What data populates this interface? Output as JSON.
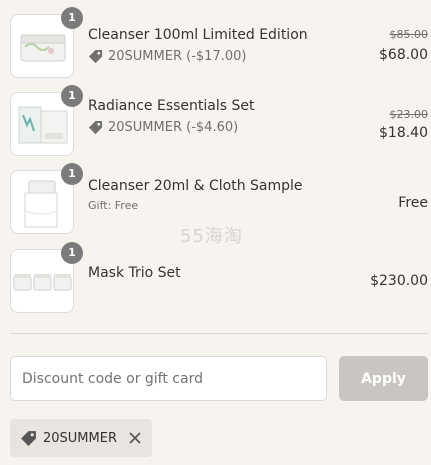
{
  "items": [
    {
      "name": "Cleanser 100ml Limited Edition",
      "quantity": "1",
      "discount_code": "20SUMMER",
      "discount_amount": "(-$17.00)",
      "original_price": "$85.00",
      "price": "$68.00"
    },
    {
      "name": "Radiance Essentials Set",
      "quantity": "1",
      "discount_code": "20SUMMER",
      "discount_amount": "(-$4.60)",
      "original_price": "$23.00",
      "price": "$18.40"
    },
    {
      "name": "Cleanser 20ml & Cloth Sample",
      "quantity": "1",
      "gift_note": "Gift: Free",
      "price": "Free"
    },
    {
      "name": "Mask Trio Set",
      "quantity": "1",
      "price": "$230.00"
    }
  ],
  "watermark": "55海淘",
  "discount_form": {
    "placeholder": "Discount code or gift card",
    "apply_label": "Apply"
  },
  "applied_discount": {
    "code": "20SUMMER"
  },
  "icons": {
    "tag": "tag-icon",
    "close": "close-icon"
  },
  "colors": {
    "background": "#f7f3ef",
    "qty_badge": "#7b7b7b",
    "apply_button": "#c9c6c2",
    "applied_tag_bg": "#e8e4df"
  }
}
